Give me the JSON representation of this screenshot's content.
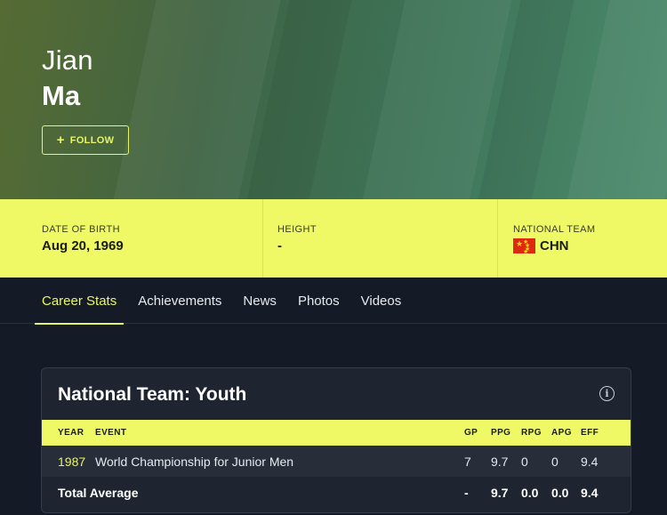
{
  "player": {
    "first_name": "Jian",
    "last_name": "Ma"
  },
  "follow": {
    "icon": "plus-icon",
    "label": "FOLLOW"
  },
  "info": {
    "dob_label": "DATE OF BIRTH",
    "dob_value": "Aug 20, 1969",
    "height_label": "HEIGHT",
    "height_value": "-",
    "team_label": "NATIONAL TEAM",
    "team_value": "CHN",
    "team_flag": "china-flag"
  },
  "tabs": [
    {
      "label": "Career Stats",
      "active": true
    },
    {
      "label": "Achievements",
      "active": false
    },
    {
      "label": "News",
      "active": false
    },
    {
      "label": "Photos",
      "active": false
    },
    {
      "label": "Videos",
      "active": false
    }
  ],
  "stats_card": {
    "title": "National Team: Youth",
    "info_icon": "info-icon",
    "columns": [
      "YEAR",
      "EVENT",
      "GP",
      "PPG",
      "RPG",
      "APG",
      "EFF"
    ],
    "rows": [
      {
        "year": "1987",
        "event": "World Championship for Junior Men",
        "gp": "7",
        "ppg": "9.7",
        "rpg": "0",
        "apg": "0",
        "eff": "9.4"
      }
    ],
    "total": {
      "label": "Total Average",
      "gp": "-",
      "ppg": "9.7",
      "rpg": "0.0",
      "apg": "0.0",
      "eff": "9.4"
    }
  },
  "colors": {
    "accent": "#eef965",
    "background": "#151b26",
    "card": "#1f2530"
  }
}
